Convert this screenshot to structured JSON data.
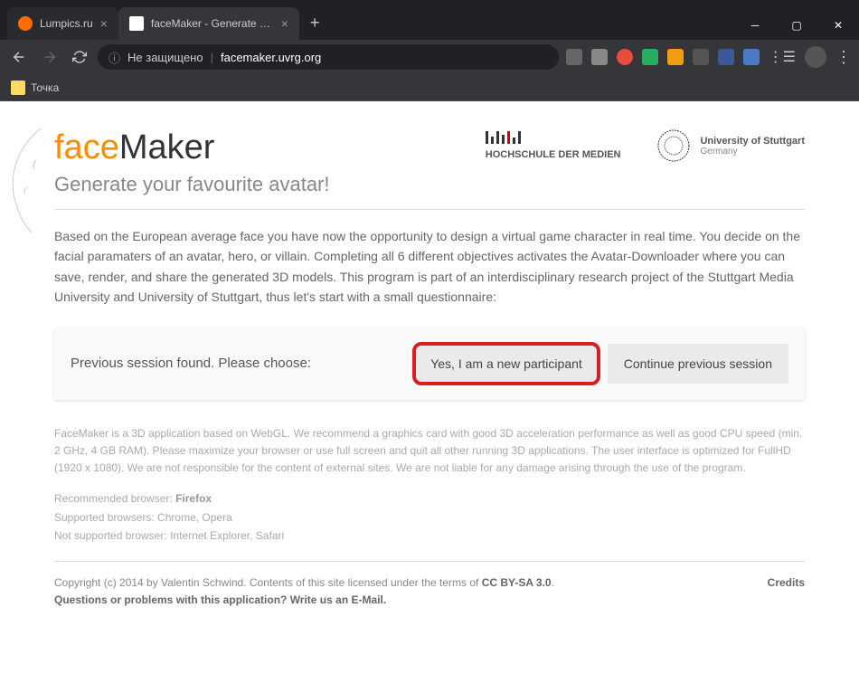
{
  "tabs": [
    {
      "title": "Lumpics.ru",
      "favColor": "orange"
    },
    {
      "title": "faceMaker - Generate your favou...",
      "favColor": "white"
    }
  ],
  "url": {
    "warning": "Не защищено",
    "domain": "facemaker.uvrg.org"
  },
  "bookmark": {
    "label": "Точка"
  },
  "page": {
    "logo_face": "face",
    "logo_maker": "Maker",
    "subtitle": "Generate your favourite avatar!",
    "partner1": "HOCHSCHULE DER MEDIEN",
    "partner2": "University of Stuttgart",
    "partner2_sub": "Germany",
    "intro": "Based on the European average face you have now the opportunity to design a virtual game character in real time. You decide on the facial paramaters of an avatar, hero, or villain. Completing all 6 different objectives activates the Avatar-Downloader where you can save, render, and share the generated 3D models. This program is part of an interdisciplinary research project of the Stuttgart Media University and University of Stuttgart, thus let's start with a small questionnaire:",
    "session_text": "Previous session found. Please choose:",
    "btn_new": "Yes, I am a new participant",
    "btn_continue": "Continue previous session",
    "requirements": "FaceMaker is a 3D application based on WebGL. We recommend a graphics card with good 3D acceleration performance as well as good CPU speed (min. 2 GHz, 4 GB RAM). Please maximize your browser or use full screen and quit all other running 3D applications. The user interface is optimized for FullHD (1920 x 1080). We are not responsible for the content of external sites. We are not liable for any damage arising through the use of the program.",
    "rec_label": "Recommended browser: ",
    "rec_val": "Firefox",
    "sup_label": "Supported browsers: Chrome, Opera",
    "nosup_label": "Not supported browser: Internet Explorer, Safari",
    "copyright": "Copyright (c) 2014 by Valentin Schwind. Contents of this site licensed under the terms of ",
    "license": "CC BY-SA 3.0",
    "questions": "Questions or problems with this application? Write us an E-Mail.",
    "credits": "Credits"
  }
}
